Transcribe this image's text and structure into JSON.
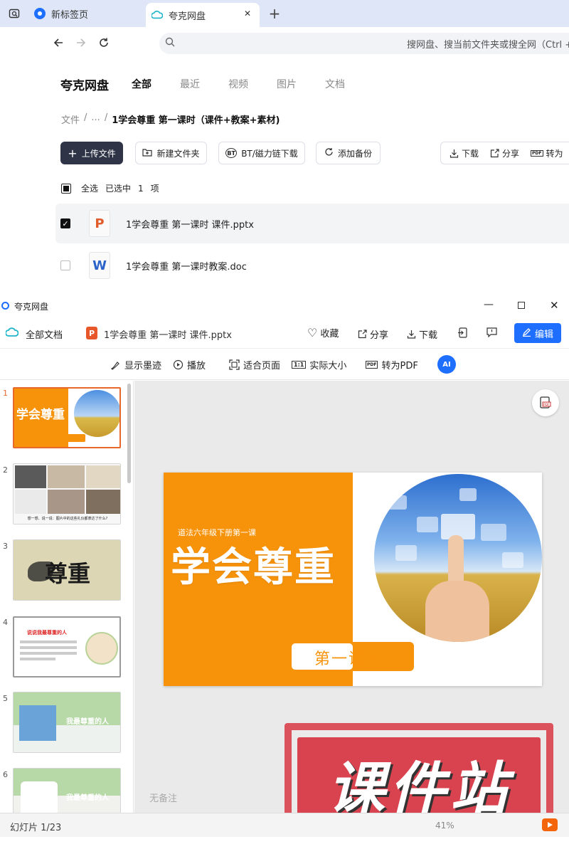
{
  "browser": {
    "tabs": [
      {
        "label": "新标签页"
      },
      {
        "label": "夸克网盘"
      }
    ],
    "new_tab": "+",
    "close": "✕",
    "omnibox_placeholder": "搜网盘、搜当前文件夹或搜全网（Ctrl + F"
  },
  "drive": {
    "brand": "夸克网盘",
    "nav": [
      "全部",
      "最近",
      "视频",
      "图片",
      "文档"
    ],
    "breadcrumb": {
      "root": "文件",
      "sep": "/",
      "ellipsis": "...",
      "current": "1学会尊重 第一课时（课件+教案+素材)"
    },
    "buttons": {
      "upload": "上传文件",
      "new_folder": "新建文件夹",
      "bt": "BT/磁力链下载",
      "backup": "添加备份",
      "download": "下载",
      "share": "分享",
      "convert": "转为"
    },
    "selection": {
      "select_all": "全选",
      "selected": "已选中",
      "count": "1",
      "unit": "项"
    },
    "files": [
      {
        "name": "1学会尊重  第一课时 课件.pptx",
        "type": "P",
        "checked": true
      },
      {
        "name": "1学会尊重  第一课时教案.doc",
        "type": "W",
        "checked": false
      }
    ]
  },
  "viewer": {
    "window_title": "夸克网盘",
    "all_docs": "全部文档",
    "file_name": "1学会尊重 第一课时 课件.pptx",
    "actions": {
      "favorite": "收藏",
      "share": "分享",
      "download": "下载",
      "edit": "编辑"
    },
    "tools": {
      "ink": "显示墨迹",
      "play": "播放",
      "fit": "适合页面",
      "actual": "实际大小",
      "pdf": "转为PDF"
    },
    "thumbnails": [
      {
        "num": "1",
        "text": "学会尊重"
      },
      {
        "num": "2",
        "text": "想一想、说一说：图片中的这些礼仪都表达了什么?"
      },
      {
        "num": "3",
        "text": "尊重"
      },
      {
        "num": "4",
        "text": "说说我最尊重的人"
      },
      {
        "num": "5",
        "text": "我最尊重的人"
      },
      {
        "num": "6",
        "text": "我最尊重的人"
      }
    ],
    "slide": {
      "subtitle": "道法六年级下册第一课",
      "title": "学会尊重",
      "lesson": "第一课时"
    },
    "watermark": "课件站",
    "notes": "无备注",
    "status": "幻灯片 1/23",
    "zoom": "41%"
  },
  "colors": {
    "accent": "#f7930a",
    "primary": "#1e6fff",
    "dark": "#2f3447",
    "watermark": "#d9434f"
  }
}
